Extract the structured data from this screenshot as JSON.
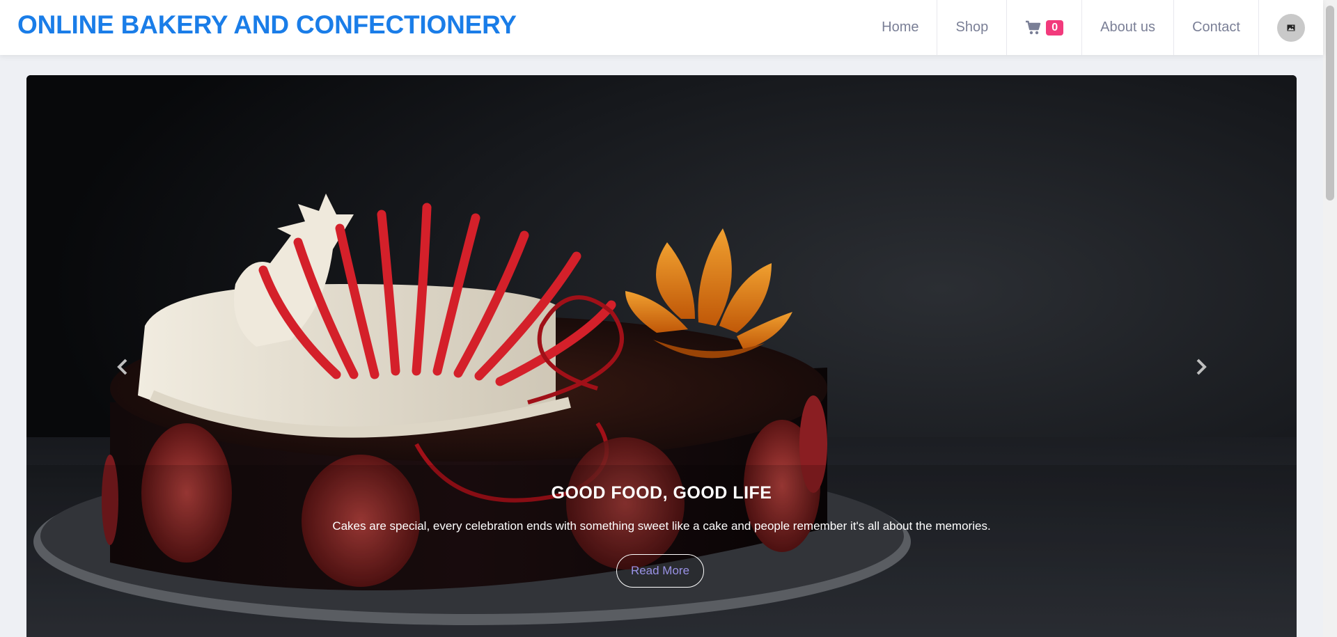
{
  "header": {
    "brand": "ONLINE BAKERY AND CONFECTIONERY",
    "nav": {
      "home": "Home",
      "shop": "Shop",
      "cart_count": "0",
      "about": "About us",
      "contact": "Contact"
    }
  },
  "hero": {
    "title": "GOOD FOOD, GOOD LIFE",
    "text": "Cakes are special, every celebration ends with something sweet like a cake and people remember it's all about the memories.",
    "button": "Read More"
  },
  "icons": {
    "cart": "cart-icon",
    "avatar": "image-icon",
    "prev": "chevron-left-icon",
    "next": "chevron-right-icon"
  },
  "colors": {
    "brand": "#1a7de8",
    "nav_text": "#7a7f96",
    "badge": "#f23a7c",
    "button_text": "#9a92e6"
  }
}
